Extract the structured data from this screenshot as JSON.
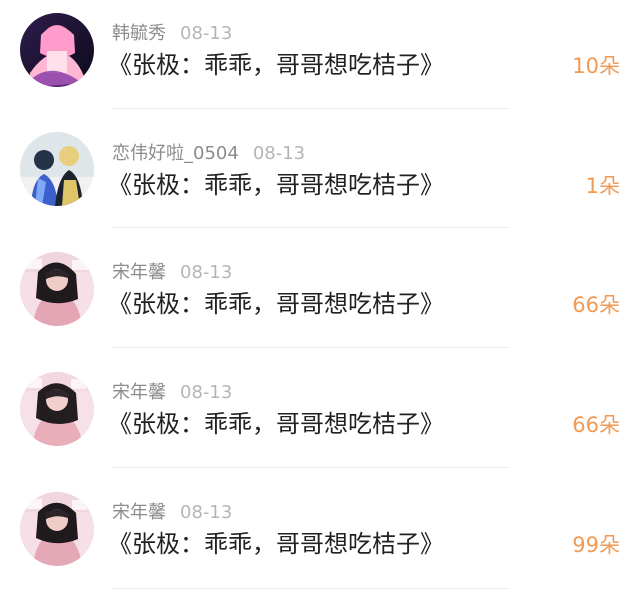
{
  "items": [
    {
      "username": "韩毓秀",
      "date": "08-13",
      "title": "《张极：乖乖，哥哥想吃桔子》",
      "count": "10朵"
    },
    {
      "username": "恋伟好啦_0504",
      "date": "08-13",
      "title": "《张极：乖乖，哥哥想吃桔子》",
      "count": "1朵"
    },
    {
      "username": "宋年馨",
      "date": "08-13",
      "title": "《张极：乖乖，哥哥想吃桔子》",
      "count": "66朵"
    },
    {
      "username": "宋年馨",
      "date": "08-13",
      "title": "《张极：乖乖，哥哥想吃桔子》",
      "count": "66朵"
    },
    {
      "username": "宋年馨",
      "date": "08-13",
      "title": "《张极：乖乖，哥哥想吃桔子》",
      "count": "99朵"
    }
  ],
  "colors": {
    "accent": "#f19a55",
    "text": "#222222",
    "meta": "#9b9b9b",
    "divider": "#ececec"
  }
}
